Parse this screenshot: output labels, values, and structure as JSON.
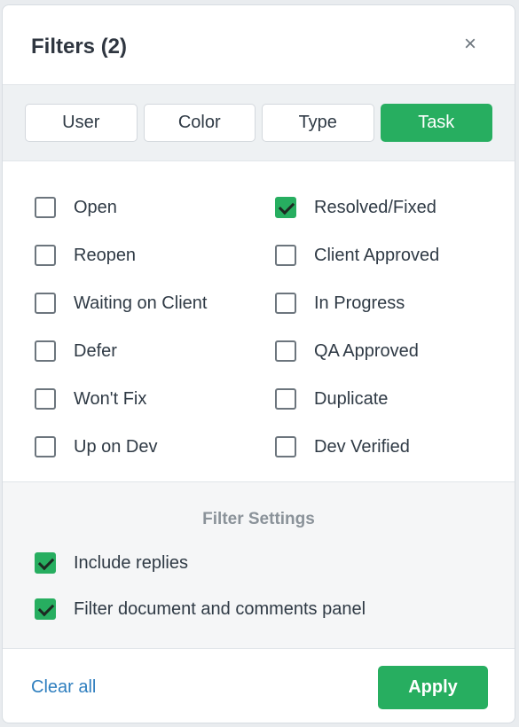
{
  "header": {
    "title": "Filters (2)",
    "close_glyph": "×"
  },
  "tabs": [
    {
      "label": "User",
      "active": false
    },
    {
      "label": "Color",
      "active": false
    },
    {
      "label": "Type",
      "active": false
    },
    {
      "label": "Task",
      "active": true
    }
  ],
  "statuses": {
    "left": [
      {
        "label": "Open",
        "checked": false
      },
      {
        "label": "Reopen",
        "checked": false
      },
      {
        "label": "Waiting on Client",
        "checked": false
      },
      {
        "label": "Defer",
        "checked": false
      },
      {
        "label": "Won't Fix",
        "checked": false
      },
      {
        "label": "Up on Dev",
        "checked": false
      }
    ],
    "right": [
      {
        "label": "Resolved/Fixed",
        "checked": true
      },
      {
        "label": "Client Approved",
        "checked": false
      },
      {
        "label": "In Progress",
        "checked": false
      },
      {
        "label": "QA Approved",
        "checked": false
      },
      {
        "label": "Duplicate",
        "checked": false
      },
      {
        "label": "Dev Verified",
        "checked": false
      }
    ]
  },
  "settings": {
    "title": "Filter Settings",
    "options": [
      {
        "label": "Include replies",
        "checked": true
      },
      {
        "label": "Filter document and comments panel",
        "checked": true
      }
    ]
  },
  "footer": {
    "clear_label": "Clear all",
    "apply_label": "Apply"
  },
  "colors": {
    "accent": "#27ae60",
    "link": "#2f7fbf"
  }
}
